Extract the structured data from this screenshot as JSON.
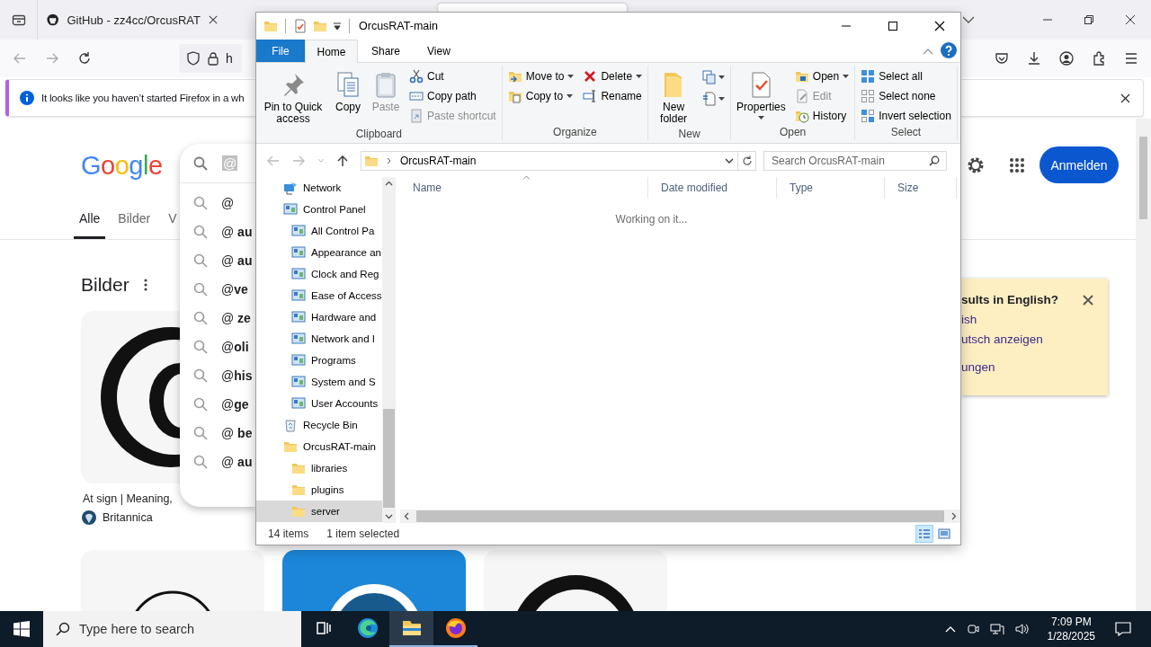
{
  "firefox": {
    "tabs": [
      {
        "label": "GitHub - zz4cc/OrcusRAT",
        "selected": false
      },
      {
        "selected": true
      }
    ],
    "url": "h",
    "notification": "It looks like you haven’t started Firefox in a wh",
    "page": {
      "logo": "Google",
      "search": {
        "value": "@",
        "suggestions": [
          "@",
          "@ **au**",
          "@ **au**",
          "@**ve**",
          "@ **ze**",
          "@**oli**",
          "@**his**",
          "@**ge**",
          "@ **be**",
          "@ **au**"
        ]
      },
      "tabs": [
        {
          "label": "Alle",
          "selected": true
        },
        {
          "label": "Bilder",
          "selected": false
        },
        {
          "label": "V",
          "selected": false
        }
      ],
      "section_title": "Bilder",
      "result": {
        "caption": "At sign | Meaning,",
        "source": "Britannica"
      },
      "sign_in": "Anmelden",
      "language_prompt": {
        "title": "sults in English?",
        "links": [
          "ish",
          "utsch anzeigen",
          "ungen"
        ]
      }
    }
  },
  "explorer": {
    "title": "OrcusRAT-main",
    "ribbon": {
      "tabs": [
        {
          "label": "File",
          "kind": "file",
          "selected": false
        },
        {
          "label": "Home",
          "kind": "tab",
          "selected": true
        },
        {
          "label": "Share",
          "kind": "tab",
          "selected": false
        },
        {
          "label": "View",
          "kind": "tab",
          "selected": false
        }
      ],
      "groups": [
        {
          "label": "Clipboard",
          "columns": [
            [
              {
                "label": "Pin to Quick access",
                "kind": "large",
                "disabled": false,
                "dropdown": false
              }
            ],
            [
              {
                "label": "Copy",
                "kind": "large",
                "disabled": false,
                "dropdown": false
              }
            ],
            [
              {
                "label": "Paste",
                "kind": "large",
                "disabled": true,
                "dropdown": false
              }
            ],
            [
              {
                "label": "Cut",
                "kind": "small",
                "disabled": false,
                "dropdown": false
              },
              {
                "label": "Copy path",
                "kind": "small",
                "disabled": false,
                "dropdown": false
              },
              {
                "label": "Paste shortcut",
                "kind": "small",
                "disabled": true,
                "dropdown": false
              }
            ]
          ]
        },
        {
          "label": "Organize",
          "columns": [
            [
              {
                "label": "Move to",
                "kind": "small",
                "disabled": false,
                "dropdown": true
              },
              {
                "label": "Copy to",
                "kind": "small",
                "disabled": false,
                "dropdown": true
              }
            ],
            [
              {
                "label": "Delete",
                "kind": "small",
                "disabled": false,
                "dropdown": true
              },
              {
                "label": "Rename",
                "kind": "small",
                "disabled": false,
                "dropdown": false
              }
            ]
          ]
        },
        {
          "label": "New",
          "columns": [
            [
              {
                "label": "New folder",
                "kind": "large",
                "disabled": false,
                "dropdown": false
              }
            ],
            [
              {
                "kind": "icon",
                "disabled": false,
                "dropdown": true
              },
              {
                "kind": "icon",
                "disabled": false,
                "dropdown": true
              }
            ]
          ]
        },
        {
          "label": "Open",
          "columns": [
            [
              {
                "label": "Properties",
                "kind": "large",
                "disabled": false,
                "dropdown": true
              }
            ],
            [
              {
                "label": "Open",
                "kind": "small",
                "disabled": false,
                "dropdown": true
              },
              {
                "label": "Edit",
                "kind": "small",
                "disabled": true,
                "dropdown": false
              },
              {
                "label": "History",
                "kind": "small",
                "disabled": false,
                "dropdown": false
              }
            ]
          ]
        },
        {
          "label": "Select",
          "columns": [
            [
              {
                "label": "Select all",
                "kind": "small",
                "disabled": false,
                "dropdown": false
              },
              {
                "label": "Select none",
                "kind": "small",
                "disabled": false,
                "dropdown": false
              },
              {
                "label": "Invert selection",
                "kind": "small",
                "disabled": false,
                "dropdown": false
              }
            ]
          ]
        }
      ]
    },
    "address": "OrcusRAT-main",
    "search_placeholder": "Search OrcusRAT-main",
    "nav": [
      {
        "label": "Network",
        "kind": "network",
        "selected": false
      },
      {
        "label": "Control Panel",
        "kind": "panel",
        "selected": false,
        "children": [
          {
            "label": "All Control Pa",
            "kind": "panel",
            "selected": false
          },
          {
            "label": "Appearance an",
            "kind": "panel",
            "selected": false
          },
          {
            "label": "Clock and Reg",
            "kind": "panel",
            "selected": false
          },
          {
            "label": "Ease of Access",
            "kind": "panel",
            "selected": false
          },
          {
            "label": "Hardware and",
            "kind": "panel",
            "selected": false
          },
          {
            "label": "Network and I",
            "kind": "panel",
            "selected": false
          },
          {
            "label": "Programs",
            "kind": "panel",
            "selected": false
          },
          {
            "label": "System and S",
            "kind": "panel",
            "selected": false
          },
          {
            "label": "User Accounts",
            "kind": "panel",
            "selected": false
          }
        ]
      },
      {
        "label": "Recycle Bin",
        "kind": "bin",
        "selected": false
      },
      {
        "label": "OrcusRAT-main",
        "kind": "folder",
        "selected": false,
        "children": [
          {
            "label": "libraries",
            "kind": "folder",
            "selected": false
          },
          {
            "label": "plugins",
            "kind": "folder",
            "selected": false
          },
          {
            "label": "server",
            "kind": "folder",
            "selected": true
          }
        ]
      }
    ],
    "columns": [
      {
        "label": "Name",
        "sorted": true
      },
      {
        "label": "Date modified",
        "sorted": false
      },
      {
        "label": "Type",
        "sorted": false
      },
      {
        "label": "Size",
        "sorted": false
      }
    ],
    "message": "Working on it...",
    "status": {
      "count": "14 items",
      "selection": "1 item selected",
      "views": [
        {
          "selected": true
        },
        {
          "selected": false
        }
      ]
    }
  },
  "taskbar": {
    "search_placeholder": "Type here to search",
    "apps": [
      {
        "kind": "taskview",
        "selected": false,
        "running": false
      },
      {
        "kind": "edge",
        "selected": false,
        "running": false
      },
      {
        "kind": "explorer",
        "selected": true,
        "running": true
      },
      {
        "kind": "firefox",
        "selected": false,
        "running": true
      }
    ],
    "time": "7:09 PM",
    "date": "1/28/2025"
  }
}
